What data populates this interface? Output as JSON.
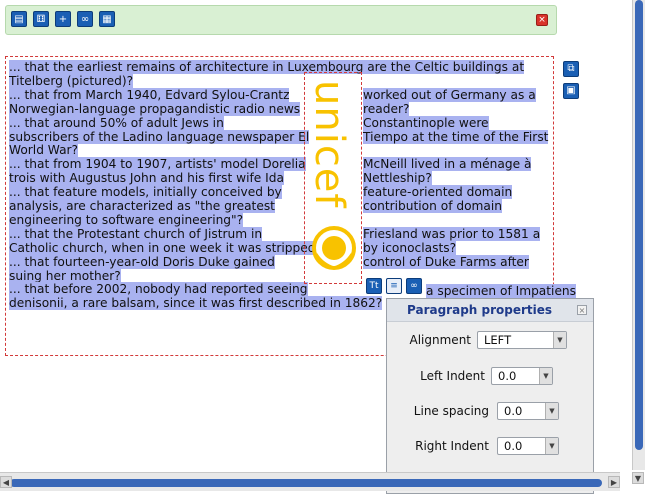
{
  "toolbar": {
    "buttons": [
      "new-doc-icon",
      "dice-icon",
      "add-icon",
      "link-icon",
      "table-icon"
    ]
  },
  "editor": {
    "left_lines": [
      "... that the earliest remains of architecture in Luxembourg are the Celtic buildings at",
      "Titelberg (pictured)?",
      "... that from March 1940, Edvard Sylou-Crantz",
      "Norwegian-language propagandistic radio news",
      "... that around 50% of adult Jews in",
      "subscribers of the Ladino language newspaper El",
      "World War?",
      "... that from 1904 to 1907, artists' model Dorelia",
      "trois with Augustus John and his first wife Ida",
      "... that feature models, initially conceived by",
      "analysis, are characterized as \"the greatest",
      "engineering to software engineering\"?",
      "... that the Protestant church of Jistrum in",
      "Catholic church, when in one week it was stripped",
      "... that fourteen-year-old Doris Duke gained",
      "suing her mother?",
      "... that before 2002, nobody had reported seeing",
      "denisonii, a rare balsam, since it was first described in 1862?"
    ],
    "right_lines": [
      "",
      "",
      "worked out of Germany as a",
      "reader?",
      "Constantinople were",
      "Tiempo at the time of the First",
      "",
      "McNeill lived in a ménage à",
      "Nettleship?",
      "feature-oriented domain",
      "contribution of domain",
      "",
      "Friesland was prior to 1581 a",
      "by iconoclasts?",
      "control of Duke Farms after",
      "",
      "",
      ""
    ],
    "impatiens_tail": "a specimen of Impatiens",
    "logo_text": "unicef"
  },
  "mini_toolbar": [
    "Tt",
    "≡",
    "link-icon"
  ],
  "paragraph_panel": {
    "title": "Paragraph properties",
    "alignment_label": "Alignment",
    "alignment_value": "LEFT",
    "left_indent_label": "Left Indent",
    "left_indent_value": "0.0",
    "line_spacing_label": "Line spacing",
    "line_spacing_value": "0.0",
    "right_indent_label": "Right Indent",
    "right_indent_value": "0.0"
  },
  "colors": {
    "selection": "#a9b2f0",
    "toolbar_bg": "#d9f0d3",
    "dashed_border": "#d23a3a",
    "logo": "#f8c200",
    "accent": "#1a5fb4"
  }
}
